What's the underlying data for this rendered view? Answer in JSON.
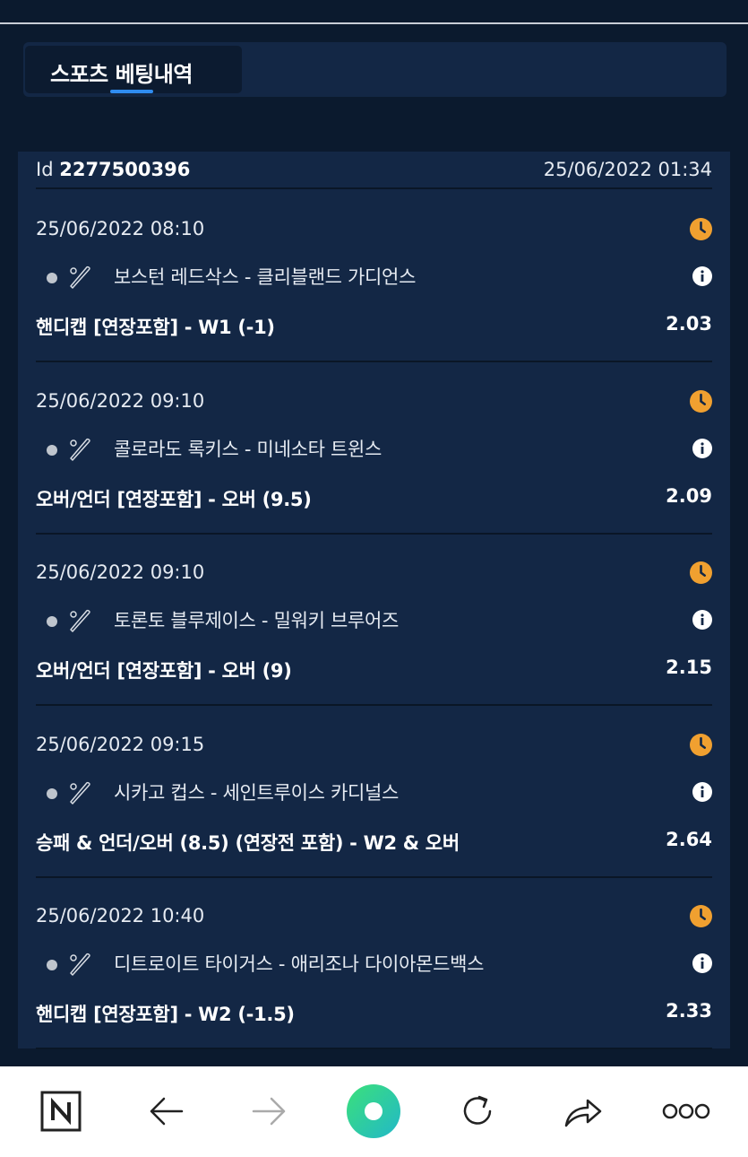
{
  "tabs": {
    "active_label": "스포츠 베팅내역"
  },
  "ticket": {
    "id_label": "Id",
    "id_value": "2277500396",
    "created_at": "25/06/2022 01:34"
  },
  "bets": [
    {
      "date": "25/06/2022 08:10",
      "match": "보스턴 레드삭스 - 클리블랜드 가디언스",
      "market": "핸디캡 [연장포함] - W1 (-1)",
      "odds": "2.03"
    },
    {
      "date": "25/06/2022 09:10",
      "match": "콜로라도 록키스 - 미네소타 트윈스",
      "market": "오버/언더 [연장포함] - 오버 (9.5)",
      "odds": "2.09"
    },
    {
      "date": "25/06/2022 09:10",
      "match": "토론토 블루제이스 - 밀워키 브루어즈",
      "market": "오버/언더 [연장포함] - 오버 (9)",
      "odds": "2.15"
    },
    {
      "date": "25/06/2022 09:15",
      "match": "시카고 컵스 - 세인트루이스 카디널스",
      "market": "승패 & 언더/오버 (8.5) (연장전 포함) - W2 & 오버",
      "odds": "2.64"
    },
    {
      "date": "25/06/2022 10:40",
      "match": "디트로이트 타이거스 - 애리조나 다이아몬드백스",
      "market": "핸디캡 [연장포함] - W2 (-1.5)",
      "odds": "2.33"
    }
  ],
  "icons": {
    "status": "clock-icon",
    "info": "info-icon",
    "sport": "baseball-icon"
  },
  "colors": {
    "background": "#0b1a2e",
    "panel": "#132745",
    "accent": "#2f8cf0",
    "pending": "#f0a030"
  },
  "browser_nav": {
    "buttons": [
      "naver-home-icon",
      "back-arrow-icon",
      "forward-arrow-icon",
      "green-dot-icon",
      "refresh-icon",
      "share-icon",
      "more-icon"
    ]
  }
}
